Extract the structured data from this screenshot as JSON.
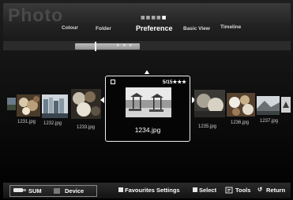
{
  "header": {
    "app_title": "Photo",
    "tabs": [
      "Colour",
      "Folder",
      "Preference",
      "Basic View",
      "Timeline"
    ],
    "selected_tab": "Preference"
  },
  "sort_bar": {
    "stars": "★ ★ ★"
  },
  "focused_item": {
    "counter": "5/15",
    "rating": "★★★",
    "filename": "1234.jpg"
  },
  "thumbnails": {
    "left": [
      "1231.jpg",
      "1232.jpg",
      "1233.jpg"
    ],
    "right": [
      "1235.jpg",
      "1236.jpg",
      "1237.jpg"
    ]
  },
  "footer": {
    "sum_label": "SUM",
    "device_label": "Device",
    "favourites_label": "Favourites Settings",
    "select_label": "Select",
    "tools_label": "Tools",
    "return_label": "Return"
  }
}
